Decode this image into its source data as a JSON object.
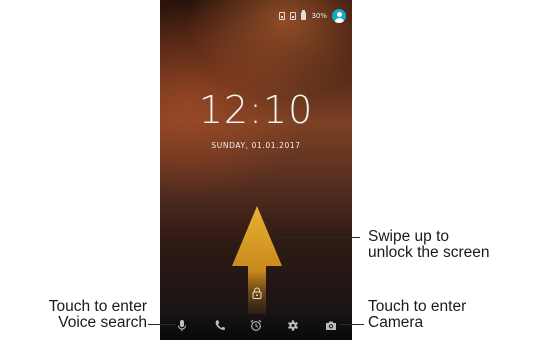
{
  "status_bar": {
    "battery_percent": "30%",
    "icons": [
      "sim-1-icon",
      "sim-2-icon",
      "battery-icon",
      "user-avatar-icon"
    ]
  },
  "lock_screen": {
    "time": "12:10",
    "date": "SUNDAY, 01.01.2017"
  },
  "bottom_bar": {
    "icons": [
      "microphone-icon",
      "phone-icon",
      "alarm-clock-icon",
      "settings-gear-icon",
      "camera-icon"
    ]
  },
  "annotations": {
    "swipe_line1": "Swipe up to",
    "swipe_line2": "unlock the screen",
    "voice_line1": "Touch to enter",
    "voice_line2": "Voice search",
    "camera_line1": "Touch to enter",
    "camera_line2": "Camera"
  },
  "colors": {
    "arrow": "#e4a92a",
    "avatar": "#13a9c8"
  }
}
